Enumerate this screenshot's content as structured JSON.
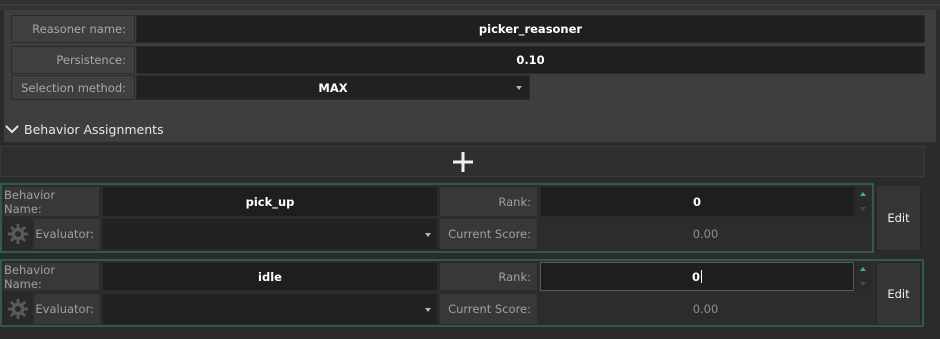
{
  "properties": {
    "reasoner_name_label": "Reasoner name:",
    "reasoner_name_value": "picker_reasoner",
    "persistence_label": "Persistence:",
    "persistence_value": "0.10",
    "selection_method_label": "Selection method:",
    "selection_method_value": "MAX"
  },
  "section": {
    "title": "Behavior Assignments",
    "add_symbol": "+"
  },
  "assignments": [
    {
      "behavior_name_label": "Behavior Name:",
      "behavior_name_value": "pick_up",
      "rank_label": "Rank:",
      "rank_value": "0",
      "evaluator_label": "Evaluator:",
      "evaluator_value": "",
      "current_score_label": "Current Score:",
      "current_score_value": "0.00",
      "edit_label": "Edit"
    },
    {
      "behavior_name_label": "Behavior Name:",
      "behavior_name_value": "idle",
      "rank_label": "Rank:",
      "rank_value": "0",
      "evaluator_label": "Evaluator:",
      "evaluator_value": "",
      "current_score_label": "Current Score:",
      "current_score_value": "0.00",
      "edit_label": "Edit"
    }
  ],
  "colors": {
    "card_border": "#2d5a55",
    "spinner_accent": "#34b39a"
  }
}
